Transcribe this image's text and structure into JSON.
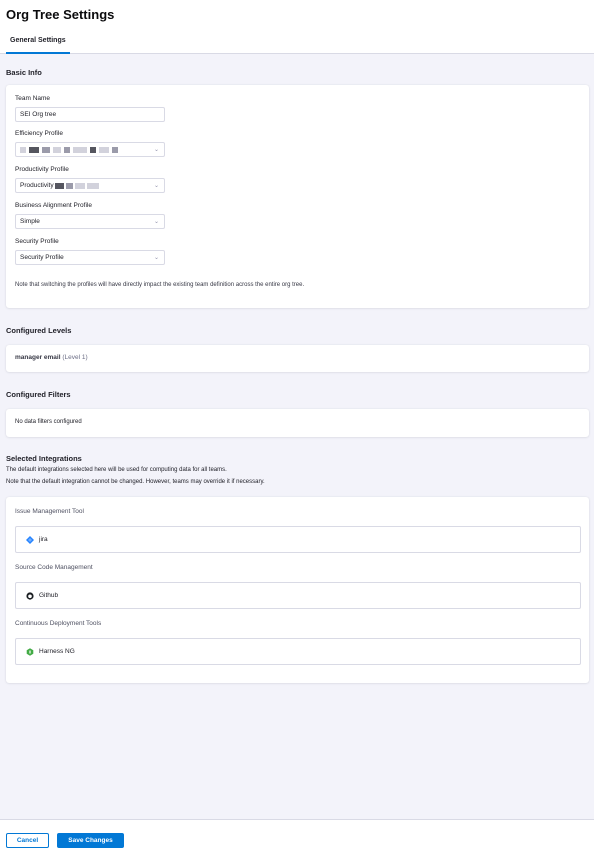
{
  "header": {
    "title": "Org Tree Settings",
    "tabs": [
      {
        "label": "General Settings",
        "active": true
      }
    ]
  },
  "basic_info": {
    "heading": "Basic Info",
    "team_name": {
      "label": "Team Name",
      "value": "SEI Org tree"
    },
    "efficiency_profile": {
      "label": "Efficiency Profile",
      "value": ""
    },
    "productivity_profile": {
      "label": "Productivity Profile",
      "value": "Productivity"
    },
    "business_alignment_profile": {
      "label": "Business Alignment Profile",
      "value": "Simple"
    },
    "security_profile": {
      "label": "Security Profile",
      "value": "Security Profile"
    },
    "note": "Note that switching the profiles will have directly impact the existing team definition across the entire org tree."
  },
  "configured_levels": {
    "heading": "Configured Levels",
    "items": [
      {
        "name": "manager email",
        "level": "(Level 1)"
      }
    ]
  },
  "configured_filters": {
    "heading": "Configured Filters",
    "empty_text": "No data filters configured"
  },
  "selected_integrations": {
    "heading": "Selected Integrations",
    "description_1": "The default integrations selected here will be used for computing data for all teams.",
    "description_2": "Note that the default integration cannot be changed. However, teams may override it if necessary.",
    "tools": [
      {
        "label": "Issue Management Tool",
        "value": "jira",
        "icon": "jira-icon"
      },
      {
        "label": "Source Code Management",
        "value": "Github",
        "icon": "github-icon"
      },
      {
        "label": "Continuous Deployment Tools",
        "value": "Harness NG",
        "icon": "harness-icon"
      }
    ]
  },
  "footer": {
    "cancel_label": "Cancel",
    "save_label": "Save Changes"
  },
  "colors": {
    "accent": "#0278d5",
    "background": "#f3f3fa",
    "jira": "#2684ff",
    "harness": "#42ab45"
  }
}
